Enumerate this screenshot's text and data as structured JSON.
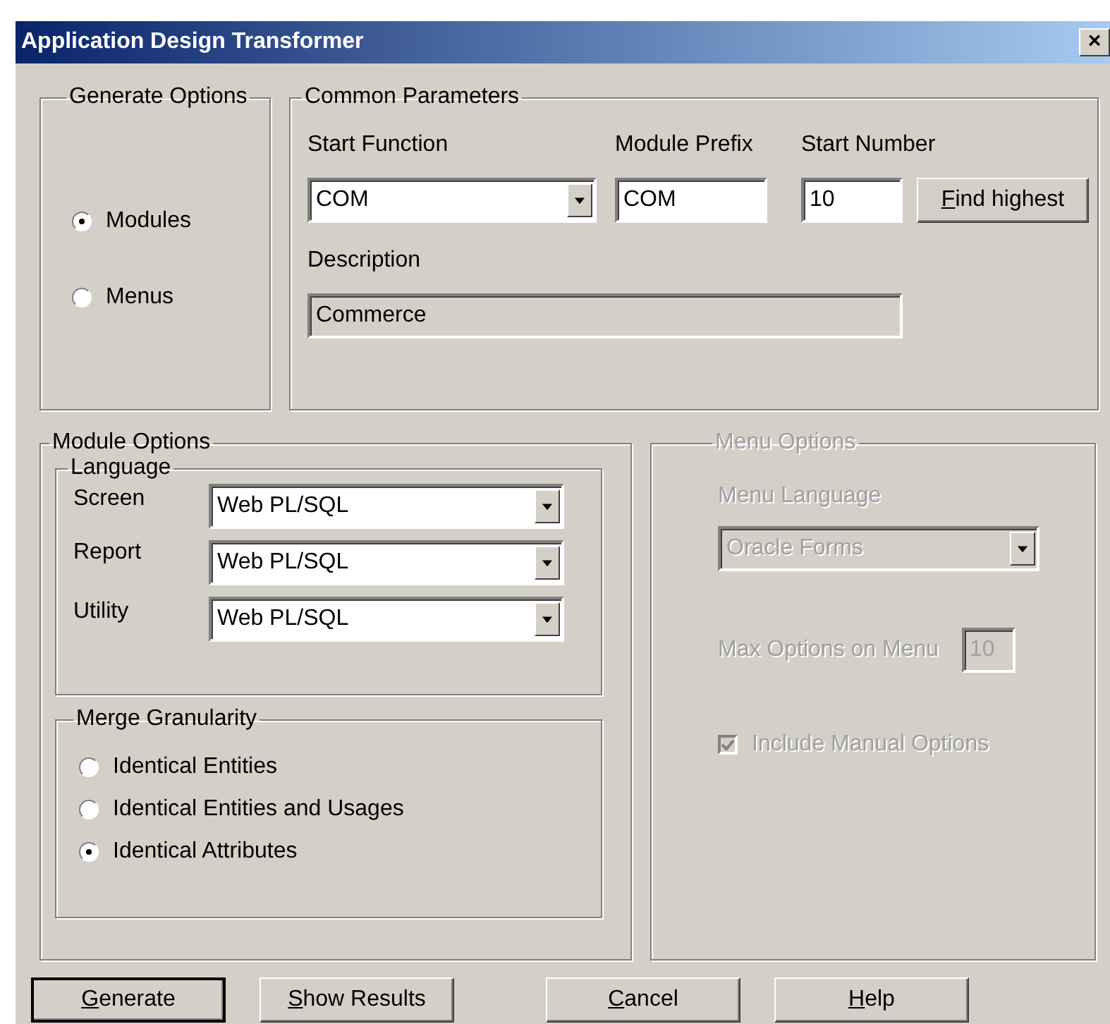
{
  "window": {
    "title": "Application Design Transformer",
    "close": "×"
  },
  "generate_options": {
    "title": "Generate Options",
    "options": [
      {
        "label": "Modules",
        "selected": true
      },
      {
        "label": "Menus",
        "selected": false
      }
    ]
  },
  "common_parameters": {
    "title": "Common Parameters",
    "start_function": {
      "label": "Start Function",
      "value": "COM"
    },
    "module_prefix": {
      "label": "Module Prefix",
      "value": "COM"
    },
    "start_number": {
      "label": "Start Number",
      "value": "10"
    },
    "find_button": "Find highest",
    "description": {
      "label": "Description",
      "value": "Commerce"
    }
  },
  "module_options": {
    "title": "Module Options",
    "language": {
      "title": "Language",
      "rows": [
        {
          "label": "Screen",
          "value": "Web PL/SQL"
        },
        {
          "label": "Report",
          "value": "Web PL/SQL"
        },
        {
          "label": "Utility",
          "value": "Web PL/SQL"
        }
      ]
    },
    "merge": {
      "title": "Merge Granularity",
      "options": [
        {
          "label": "Identical Entities",
          "selected": false
        },
        {
          "label": "Identical Entities and Usages",
          "selected": false
        },
        {
          "label": "Identical Attributes",
          "selected": true
        }
      ]
    }
  },
  "menu_options": {
    "title": "Menu Options",
    "disabled": true,
    "menu_language": {
      "label": "Menu Language",
      "value": "Oracle Forms"
    },
    "max_options": {
      "label": "Max Options on Menu",
      "value": "10"
    },
    "include_manual": {
      "label": "Include Manual Options",
      "checked": true
    }
  },
  "buttons": [
    {
      "label": "Generate",
      "default": true
    },
    {
      "label": "Show Results",
      "default": false
    },
    {
      "label": "Cancel",
      "default": false
    },
    {
      "label": "Help",
      "default": false
    }
  ]
}
